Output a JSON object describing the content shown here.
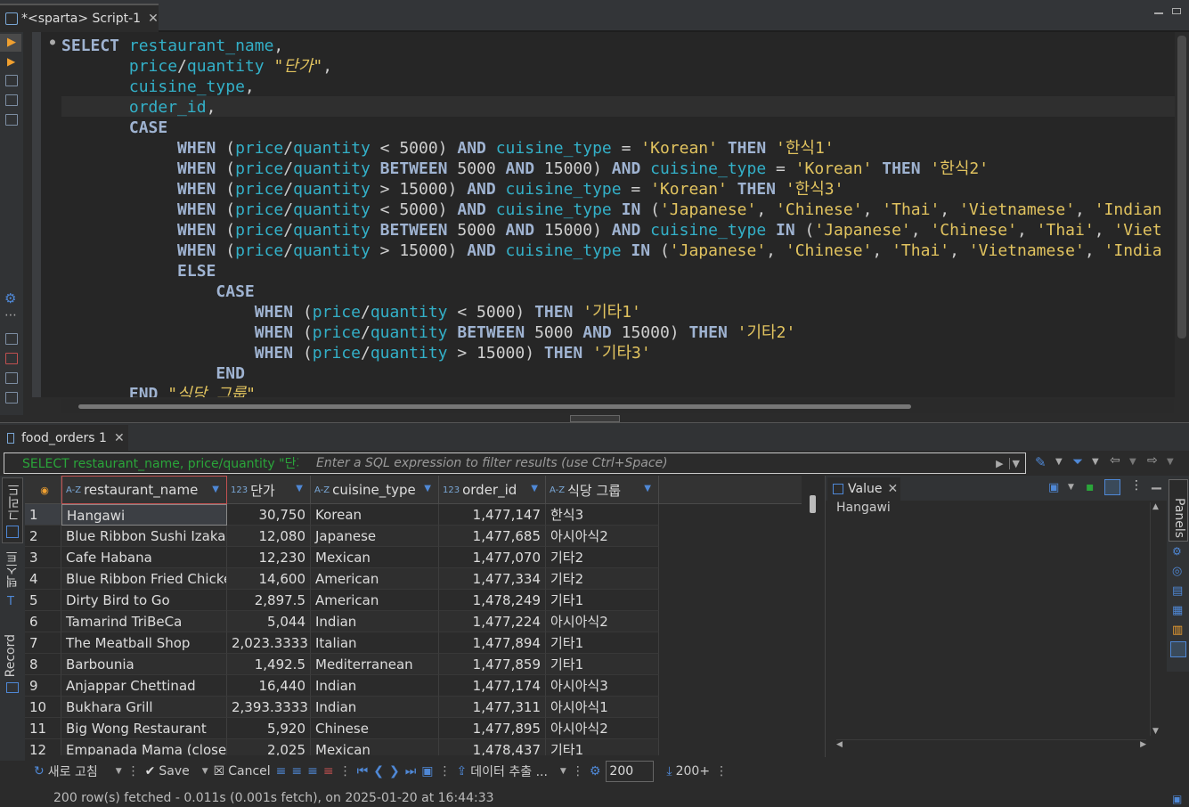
{
  "editor_tab": {
    "title": "*<sparta> Script-1"
  },
  "code_lines": [
    [
      [
        "SELECT ",
        "kw"
      ],
      [
        "restaurant_name",
        "id"
      ],
      [
        ",",
        "op"
      ]
    ],
    [
      [
        "       ",
        "op"
      ],
      [
        "price",
        "id"
      ],
      [
        "/",
        "op"
      ],
      [
        "quantity",
        "id"
      ],
      [
        " ",
        "op"
      ],
      [
        "\"단가\"",
        "al"
      ],
      [
        ",",
        "op"
      ]
    ],
    [
      [
        "       ",
        "op"
      ],
      [
        "cuisine_type",
        "id"
      ],
      [
        ",",
        "op"
      ]
    ],
    [
      [
        "       ",
        "op"
      ],
      [
        "order_id",
        "id"
      ],
      [
        ",",
        "op"
      ]
    ],
    [
      [
        "       ",
        "op"
      ],
      [
        "CASE",
        "kw"
      ]
    ],
    [
      [
        "            ",
        "op"
      ],
      [
        "WHEN ",
        "kw"
      ],
      [
        "(",
        "op"
      ],
      [
        "price",
        "id"
      ],
      [
        "/",
        "op"
      ],
      [
        "quantity",
        "id"
      ],
      [
        " < 5000) ",
        "op"
      ],
      [
        "AND ",
        "kw"
      ],
      [
        "cuisine_type",
        "id"
      ],
      [
        " = ",
        "op"
      ],
      [
        "'Korean'",
        "str"
      ],
      [
        " THEN ",
        "kw"
      ],
      [
        "'한식1'",
        "str"
      ]
    ],
    [
      [
        "            ",
        "op"
      ],
      [
        "WHEN ",
        "kw"
      ],
      [
        "(",
        "op"
      ],
      [
        "price",
        "id"
      ],
      [
        "/",
        "op"
      ],
      [
        "quantity",
        "id"
      ],
      [
        " ",
        "op"
      ],
      [
        "BETWEEN ",
        "kw"
      ],
      [
        "5000 ",
        "op"
      ],
      [
        "AND ",
        "kw"
      ],
      [
        "15000) ",
        "op"
      ],
      [
        "AND ",
        "kw"
      ],
      [
        "cuisine_type",
        "id"
      ],
      [
        " = ",
        "op"
      ],
      [
        "'Korean'",
        "str"
      ],
      [
        " THEN ",
        "kw"
      ],
      [
        "'한식2'",
        "str"
      ]
    ],
    [
      [
        "            ",
        "op"
      ],
      [
        "WHEN ",
        "kw"
      ],
      [
        "(",
        "op"
      ],
      [
        "price",
        "id"
      ],
      [
        "/",
        "op"
      ],
      [
        "quantity",
        "id"
      ],
      [
        " > 15000) ",
        "op"
      ],
      [
        "AND ",
        "kw"
      ],
      [
        "cuisine_type",
        "id"
      ],
      [
        " = ",
        "op"
      ],
      [
        "'Korean'",
        "str"
      ],
      [
        " THEN ",
        "kw"
      ],
      [
        "'한식3'",
        "str"
      ]
    ],
    [
      [
        "            ",
        "op"
      ],
      [
        "WHEN ",
        "kw"
      ],
      [
        "(",
        "op"
      ],
      [
        "price",
        "id"
      ],
      [
        "/",
        "op"
      ],
      [
        "quantity",
        "id"
      ],
      [
        " < 5000) ",
        "op"
      ],
      [
        "AND ",
        "kw"
      ],
      [
        "cuisine_type",
        "id"
      ],
      [
        " IN ",
        "kw"
      ],
      [
        "(",
        "op"
      ],
      [
        "'Japanese'",
        "str"
      ],
      [
        ", ",
        "op"
      ],
      [
        "'Chinese'",
        "str"
      ],
      [
        ", ",
        "op"
      ],
      [
        "'Thai'",
        "str"
      ],
      [
        ", ",
        "op"
      ],
      [
        "'Vietnamese'",
        "str"
      ],
      [
        ", ",
        "op"
      ],
      [
        "'Indian",
        "str"
      ]
    ],
    [
      [
        "            ",
        "op"
      ],
      [
        "WHEN ",
        "kw"
      ],
      [
        "(",
        "op"
      ],
      [
        "price",
        "id"
      ],
      [
        "/",
        "op"
      ],
      [
        "quantity",
        "id"
      ],
      [
        " ",
        "op"
      ],
      [
        "BETWEEN ",
        "kw"
      ],
      [
        "5000 ",
        "op"
      ],
      [
        "AND ",
        "kw"
      ],
      [
        "15000) ",
        "op"
      ],
      [
        "AND ",
        "kw"
      ],
      [
        "cuisine_type",
        "id"
      ],
      [
        " IN ",
        "kw"
      ],
      [
        "(",
        "op"
      ],
      [
        "'Japanese'",
        "str"
      ],
      [
        ", ",
        "op"
      ],
      [
        "'Chinese'",
        "str"
      ],
      [
        ", ",
        "op"
      ],
      [
        "'Thai'",
        "str"
      ],
      [
        ", ",
        "op"
      ],
      [
        "'Viet",
        "str"
      ]
    ],
    [
      [
        "            ",
        "op"
      ],
      [
        "WHEN ",
        "kw"
      ],
      [
        "(",
        "op"
      ],
      [
        "price",
        "id"
      ],
      [
        "/",
        "op"
      ],
      [
        "quantity",
        "id"
      ],
      [
        " > 15000) ",
        "op"
      ],
      [
        "AND ",
        "kw"
      ],
      [
        "cuisine_type",
        "id"
      ],
      [
        " IN ",
        "kw"
      ],
      [
        "(",
        "op"
      ],
      [
        "'Japanese'",
        "str"
      ],
      [
        ", ",
        "op"
      ],
      [
        "'Chinese'",
        "str"
      ],
      [
        ", ",
        "op"
      ],
      [
        "'Thai'",
        "str"
      ],
      [
        ", ",
        "op"
      ],
      [
        "'Vietnamese'",
        "str"
      ],
      [
        ", ",
        "op"
      ],
      [
        "'India",
        "str"
      ]
    ],
    [
      [
        "            ",
        "op"
      ],
      [
        "ELSE",
        "kw"
      ]
    ],
    [
      [
        "                ",
        "op"
      ],
      [
        "CASE",
        "kw"
      ]
    ],
    [
      [
        "                    ",
        "op"
      ],
      [
        "WHEN ",
        "kw"
      ],
      [
        "(",
        "op"
      ],
      [
        "price",
        "id"
      ],
      [
        "/",
        "op"
      ],
      [
        "quantity",
        "id"
      ],
      [
        " < 5000) ",
        "op"
      ],
      [
        "THEN ",
        "kw"
      ],
      [
        "'기타1'",
        "str"
      ]
    ],
    [
      [
        "                    ",
        "op"
      ],
      [
        "WHEN ",
        "kw"
      ],
      [
        "(",
        "op"
      ],
      [
        "price",
        "id"
      ],
      [
        "/",
        "op"
      ],
      [
        "quantity",
        "id"
      ],
      [
        " ",
        "op"
      ],
      [
        "BETWEEN ",
        "kw"
      ],
      [
        "5000 ",
        "op"
      ],
      [
        "AND ",
        "kw"
      ],
      [
        "15000) ",
        "op"
      ],
      [
        "THEN ",
        "kw"
      ],
      [
        "'기타2'",
        "str"
      ]
    ],
    [
      [
        "                    ",
        "op"
      ],
      [
        "WHEN ",
        "kw"
      ],
      [
        "(",
        "op"
      ],
      [
        "price",
        "id"
      ],
      [
        "/",
        "op"
      ],
      [
        "quantity",
        "id"
      ],
      [
        " > 15000) ",
        "op"
      ],
      [
        "THEN ",
        "kw"
      ],
      [
        "'기타3'",
        "str"
      ]
    ],
    [
      [
        "                ",
        "op"
      ],
      [
        "END",
        "kw"
      ]
    ],
    [
      [
        "       ",
        "op"
      ],
      [
        "END ",
        "kw"
      ],
      [
        "\"식당 그룹\"",
        "al"
      ]
    ]
  ],
  "result_tab": {
    "title": "food_orders 1"
  },
  "filter": {
    "sql": "SELECT restaurant_name, price/quantity \"단가\"",
    "placeholder": "Enter a SQL expression to filter results (use Ctrl+Space)"
  },
  "side_tabs": {
    "grid": "그리드",
    "text": "텍스트",
    "record": "Record"
  },
  "columns": [
    {
      "type": "A-Z",
      "name": "restaurant_name"
    },
    {
      "type": "123",
      "name": "단가"
    },
    {
      "type": "A-Z",
      "name": "cuisine_type"
    },
    {
      "type": "123",
      "name": "order_id"
    },
    {
      "type": "A-Z",
      "name": "식당 그룹"
    }
  ],
  "rows": [
    [
      "1",
      "Hangawi",
      "30,750",
      "Korean",
      "1,477,147",
      "한식3"
    ],
    [
      "2",
      "Blue Ribbon Sushi Izakaya",
      "12,080",
      "Japanese",
      "1,477,685",
      "아시아식2"
    ],
    [
      "3",
      "Cafe Habana",
      "12,230",
      "Mexican",
      "1,477,070",
      "기타2"
    ],
    [
      "4",
      "Blue Ribbon Fried Chicken",
      "14,600",
      "American",
      "1,477,334",
      "기타2"
    ],
    [
      "5",
      "Dirty Bird to Go",
      "2,897.5",
      "American",
      "1,478,249",
      "기타1"
    ],
    [
      "6",
      "Tamarind TriBeCa",
      "5,044",
      "Indian",
      "1,477,224",
      "아시아식2"
    ],
    [
      "7",
      "The Meatball Shop",
      "2,023.3333",
      "Italian",
      "1,477,894",
      "기타1"
    ],
    [
      "8",
      "Barbounia",
      "1,492.5",
      "Mediterranean",
      "1,477,859",
      "기타1"
    ],
    [
      "9",
      "Anjappar Chettinad",
      "16,440",
      "Indian",
      "1,477,174",
      "아시아식3"
    ],
    [
      "10",
      "Bukhara Grill",
      "2,393.3333",
      "Indian",
      "1,477,311",
      "아시아식1"
    ],
    [
      "11",
      "Big Wong Restaurant",
      "5,920",
      "Chinese",
      "1,477,895",
      "아시아식2"
    ],
    [
      "12",
      "Empanada Mama (closed)",
      "2,025",
      "Mexican",
      "1,478,437",
      "기타1"
    ]
  ],
  "value_panel": {
    "tab": "Value",
    "content": "Hangawi",
    "side_label": "Panels"
  },
  "bottom_toolbar": {
    "refresh": "새로 고침",
    "save": "Save",
    "cancel": "Cancel",
    "export": "데이터 추출 ...",
    "fetch_size": "200",
    "fetch_more": "200+"
  },
  "status": "200 row(s) fetched - 0.011s (0.001s fetch), on 2025-01-20 at 16:44:33"
}
